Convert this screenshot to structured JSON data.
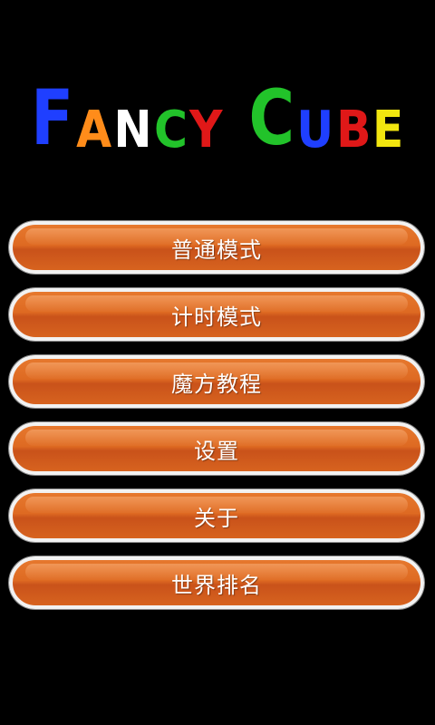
{
  "title": {
    "letters": [
      {
        "char": "F",
        "color": "#1f3fff",
        "size": "big"
      },
      {
        "char": "A",
        "color": "#ff8c1a",
        "size": "small"
      },
      {
        "char": "N",
        "color": "#ffffff",
        "size": "small"
      },
      {
        "char": "C",
        "color": "#22c32a",
        "size": "small"
      },
      {
        "char": "Y",
        "color": "#e01818",
        "size": "small"
      },
      {
        "char": "C",
        "color": "#22c32a",
        "size": "big"
      },
      {
        "char": "U",
        "color": "#1f3fff",
        "size": "small"
      },
      {
        "char": "B",
        "color": "#e01818",
        "size": "small"
      },
      {
        "char": "E",
        "color": "#f2e60f",
        "size": "small"
      }
    ]
  },
  "menu": {
    "items": [
      {
        "label": "普通模式"
      },
      {
        "label": "计时模式"
      },
      {
        "label": "魔方教程"
      },
      {
        "label": "设置"
      },
      {
        "label": "关于"
      },
      {
        "label": "世界排名"
      }
    ]
  },
  "colors": {
    "background": "#000000",
    "button_orange": "#de6a22",
    "button_border": "#f2f2f2"
  }
}
